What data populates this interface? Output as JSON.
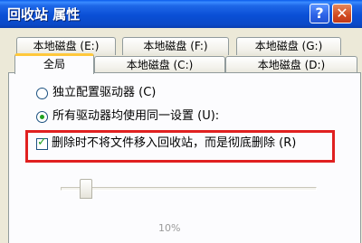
{
  "window": {
    "title": "回收站 属性"
  },
  "titlebar": {
    "help_glyph": "?",
    "close_glyph": "✕"
  },
  "tabs_back": [
    "本地磁盘 (E:)",
    "本地磁盘 (F:)",
    "本地磁盘 (G:)"
  ],
  "tabs_front": [
    "全局",
    "本地磁盘 (C:)",
    "本地磁盘 (D:)"
  ],
  "options": {
    "independent": {
      "label": "独立配置驱动器 (C)",
      "selected": false
    },
    "all_same": {
      "label": "所有驱动器均使用同一设置 (U):",
      "selected": true
    },
    "delete_immediately": {
      "label": "删除时不将文件移入回收站，而是彻底删除 (R)",
      "checked": true
    }
  },
  "slider": {
    "percent_label": "10%",
    "value_percent": 10
  },
  "colors": {
    "titlebar": "#0A4FD6",
    "highlight": "#E02020",
    "active_tab_accent": "#FFC83C",
    "window_bg": "#ECE9D8"
  }
}
